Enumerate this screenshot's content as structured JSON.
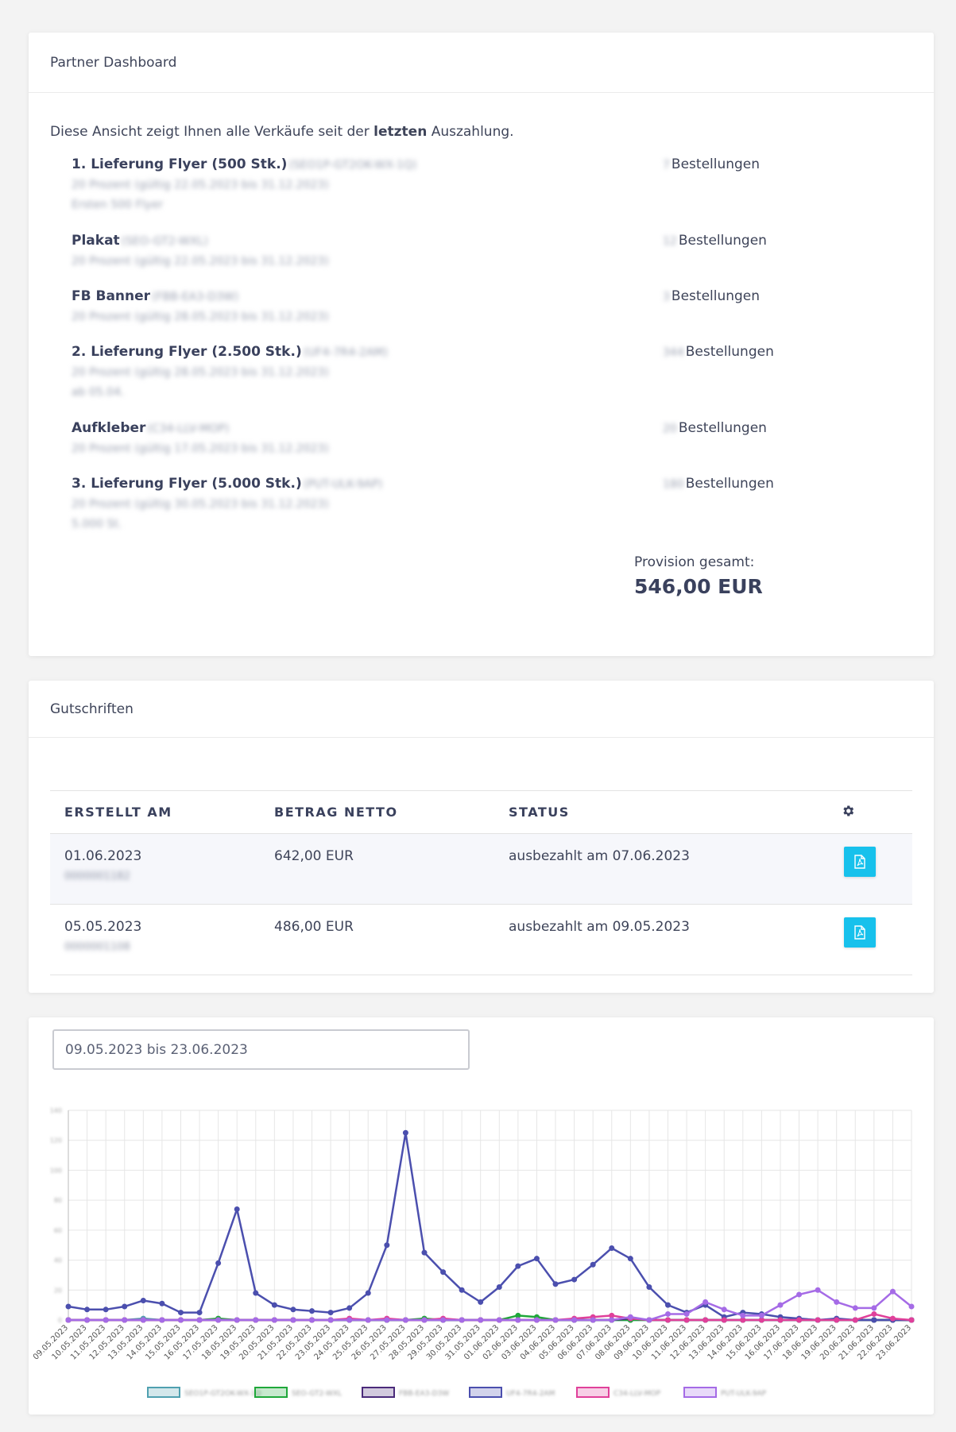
{
  "dashboard": {
    "title": "Partner Dashboard",
    "intro_pre": "Diese Ansicht zeigt Ihnen alle Verkäufe seit der ",
    "intro_bold": "letzten",
    "intro_post": " Auszahlung.",
    "orders_label": "Bestellungen",
    "products": [
      {
        "name": "1. Lieferung Flyer (500 Stk.)",
        "code": "(SEO1P-GT2OK-WX-1Q)",
        "lines": [
          "20 Prozent (gültig 22.05.2023 bis 31.12.2023)",
          "Ersten 500 Flyer"
        ],
        "count": "7"
      },
      {
        "name": "Plakat",
        "code": "(SEO-GT2-WXL)",
        "lines": [
          "20 Prozent (gültig 22.05.2023 bis 31.12.2023)"
        ],
        "count": "12"
      },
      {
        "name": "FB Banner",
        "code": "(FBB-EA3-D3W)",
        "lines": [
          "20 Prozent (gültig 28.05.2023 bis 31.12.2023)"
        ],
        "count": "3"
      },
      {
        "name": "2. Lieferung Flyer (2.500 Stk.)",
        "code": "(UF4-7R4-2AM)",
        "lines": [
          "20 Prozent (gültig 28.05.2023 bis 31.12.2023)",
          "ab 05.04."
        ],
        "count": "344"
      },
      {
        "name": "Aufkleber",
        "code": "(C34-LLV-MOP)",
        "lines": [
          "20 Prozent (gültig 17.05.2023 bis 31.12.2023)"
        ],
        "count": "20"
      },
      {
        "name": "3. Lieferung Flyer (5.000 Stk.)",
        "code": "(PUT-ULK-9AP)",
        "lines": [
          "20 Prozent (gültig 30.05.2023 bis 31.12.2023)",
          "5.000 St."
        ],
        "count": "180"
      }
    ],
    "provision_label": "Provision gesamt:",
    "provision_value": "546,00 EUR"
  },
  "credits": {
    "title": "Gutschriften",
    "headers": {
      "created": "ERSTELLT AM",
      "amount": "BETRAG NETTO",
      "status": "STATUS"
    },
    "rows": [
      {
        "date": "01.06.2023",
        "id": "0000001182",
        "amount": "642,00 EUR",
        "status": "ausbezahlt am 07.06.2023"
      },
      {
        "date": "05.05.2023",
        "id": "0000001108",
        "amount": "486,00 EUR",
        "status": "ausbezahlt am 09.05.2023"
      }
    ]
  },
  "chart_section": {
    "date_range": "09.05.2023 bis 23.06.2023"
  },
  "chart_data": {
    "type": "line",
    "x": [
      "09.05.2023",
      "10.05.2023",
      "11.05.2023",
      "12.05.2023",
      "13.05.2023",
      "14.05.2023",
      "15.05.2023",
      "16.05.2023",
      "17.05.2023",
      "18.05.2023",
      "19.05.2023",
      "20.05.2023",
      "21.05.2023",
      "22.05.2023",
      "23.05.2023",
      "24.05.2023",
      "25.05.2023",
      "26.05.2023",
      "27.05.2023",
      "28.05.2023",
      "29.05.2023",
      "30.05.2023",
      "31.05.2023",
      "01.06.2023",
      "02.06.2023",
      "03.06.2023",
      "04.06.2023",
      "05.06.2023",
      "06.06.2023",
      "07.06.2023",
      "08.06.2023",
      "09.06.2023",
      "10.06.2023",
      "11.06.2023",
      "12.06.2023",
      "13.06.2023",
      "14.06.2023",
      "15.06.2023",
      "16.06.2023",
      "17.06.2023",
      "18.06.2023",
      "19.06.2023",
      "20.06.2023",
      "21.06.2023",
      "22.06.2023",
      "23.06.2023"
    ],
    "ylim": [
      0,
      140
    ],
    "yticks": [
      "0",
      "20",
      "40",
      "60",
      "80",
      "100",
      "120",
      "140"
    ],
    "series": [
      {
        "name": "SEO1P-GT2OK-WX-1Q",
        "color": "#4fa0b0",
        "values": [
          0,
          0,
          0,
          0,
          1,
          0,
          0,
          0,
          0,
          0,
          0,
          0,
          0,
          0,
          0,
          0,
          0,
          0,
          0,
          0,
          0,
          0,
          0,
          0,
          0,
          0,
          0,
          0,
          0,
          0,
          0,
          0,
          0,
          0,
          0,
          0,
          0,
          0,
          0,
          0,
          0,
          0,
          0,
          0,
          0,
          0
        ]
      },
      {
        "name": "SEO-GT2-WXL",
        "color": "#1fa83a",
        "values": [
          0,
          0,
          0,
          0,
          0,
          0,
          0,
          0,
          1,
          0,
          0,
          0,
          0,
          0,
          0,
          0,
          0,
          0,
          0,
          1,
          0,
          0,
          0,
          0,
          3,
          2,
          0,
          0,
          0,
          0,
          0,
          0,
          0,
          0,
          0,
          0,
          0,
          0,
          0,
          0,
          0,
          0,
          0,
          0,
          0,
          0
        ]
      },
      {
        "name": "FBB-EA3-D3W",
        "color": "#4a2a7a",
        "values": [
          0,
          0,
          0,
          0,
          0,
          0,
          0,
          0,
          0,
          0,
          0,
          0,
          0,
          0,
          0,
          0,
          0,
          0,
          0,
          0,
          0,
          0,
          0,
          0,
          0,
          0,
          0,
          0,
          0,
          0,
          1,
          0,
          0,
          0,
          0,
          0,
          0,
          0,
          0,
          0,
          0,
          0,
          0,
          0,
          0,
          0
        ]
      },
      {
        "name": "UF4-7R4-2AM",
        "color": "#4b4fae",
        "values": [
          9,
          7,
          7,
          9,
          13,
          11,
          5,
          5,
          38,
          74,
          18,
          10,
          7,
          6,
          5,
          8,
          18,
          50,
          125,
          45,
          32,
          20,
          12,
          22,
          36,
          41,
          24,
          27,
          37,
          48,
          41,
          22,
          10,
          5,
          10,
          2,
          5,
          4,
          2,
          1,
          0,
          1,
          0,
          0,
          0,
          0
        ]
      },
      {
        "name": "C34-LLV-MOP",
        "color": "#e0409a",
        "values": [
          0,
          0,
          0,
          0,
          0,
          0,
          0,
          0,
          0,
          0,
          0,
          0,
          0,
          0,
          0,
          1,
          0,
          1,
          0,
          0,
          1,
          0,
          0,
          0,
          0,
          0,
          0,
          1,
          2,
          3,
          1,
          0,
          0,
          0,
          0,
          0,
          0,
          0,
          0,
          0,
          0,
          0,
          0,
          4,
          1,
          0
        ]
      },
      {
        "name": "PUT-ULK-9AP",
        "color": "#a56be6",
        "values": [
          0,
          0,
          0,
          0,
          0,
          0,
          0,
          0,
          0,
          0,
          0,
          0,
          0,
          0,
          0,
          0,
          0,
          0,
          0,
          0,
          0,
          0,
          0,
          0,
          0,
          0,
          0,
          0,
          0,
          0,
          2,
          0,
          4,
          4,
          12,
          7,
          3,
          3,
          10,
          17,
          20,
          12,
          8,
          8,
          19,
          9
        ]
      }
    ]
  }
}
